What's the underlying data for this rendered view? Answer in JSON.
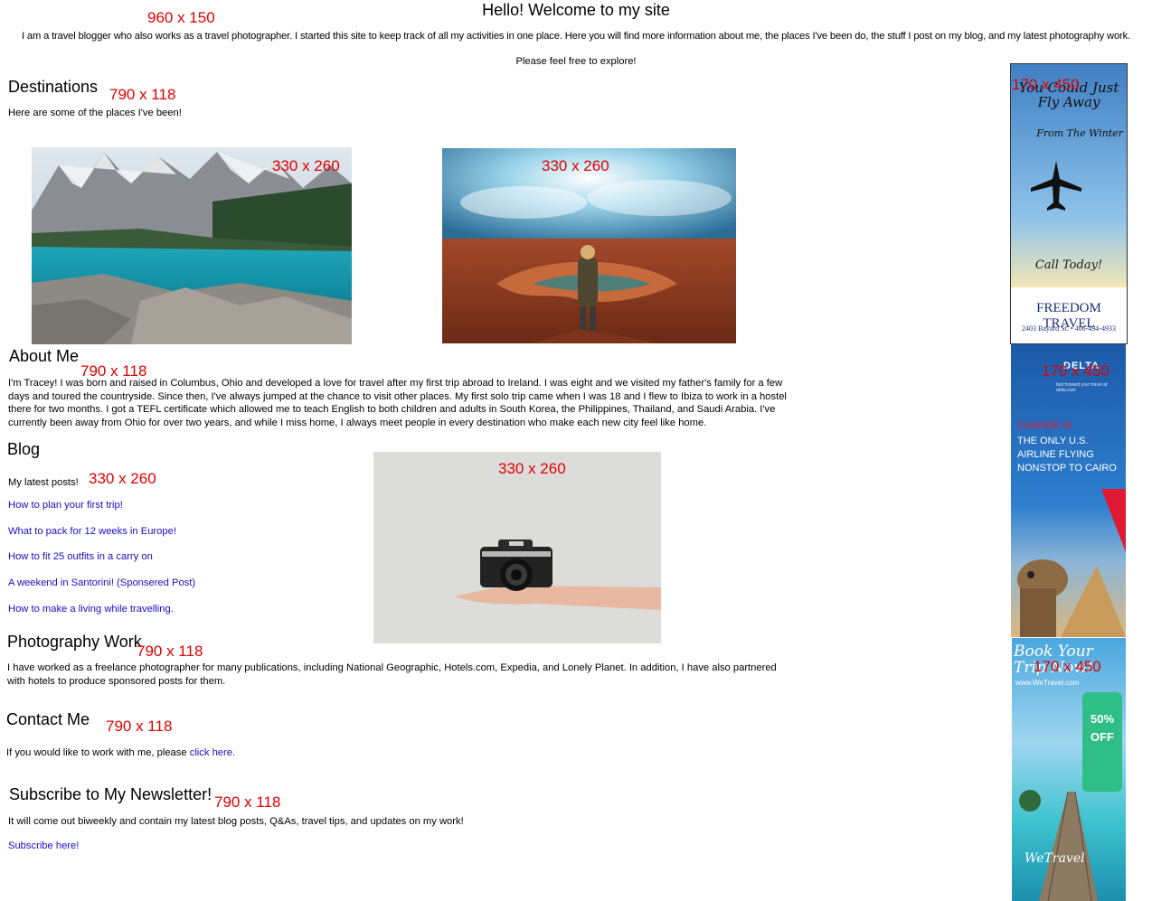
{
  "header": {
    "dim_label": "960 x 150",
    "title": "Hello! Welcome to my site",
    "intro": "I am a travel blogger who also works as a travel photographer. I started this site to keep track of all my activities in one place. Here you will find more information about me, the places I've been do, the stuff I post on my blog, and my latest photography work.",
    "intro2": "Please feel free to explore!"
  },
  "destinations": {
    "heading": "Destinations",
    "dim_label": "790 x 118",
    "text": "Here are some of the places I've been!",
    "photo1_dim": "330 x 260",
    "photo2_dim": "330 x 260"
  },
  "about": {
    "heading": "About Me",
    "dim_label": "790 x 118",
    "text": "I'm Tracey! I was born and raised in Columbus, Ohio and developed a love for travel after my first trip abroad to Ireland. I was eight and we visited my father's family for a few days and toured the countryside. Since then, I've always jumped at the chance to visit other places. My first solo trip came when I was 18 and I flew to Ibiza to work in a hostel there for two months. I got a TEFL certificate which allowed me to teach English to both children and adults in South Korea, the Philippines, Thailand, and Saudi Arabia. I've currently been away from Ohio for over two years, and while I miss home, I always meet people in every destination who make each new city feel like home."
  },
  "blog": {
    "heading": "Blog",
    "latest": "My latest posts!",
    "dim_label": "330 x 260",
    "photo_dim": "330 x 260",
    "posts": [
      "How to plan your first trip!",
      "What to pack for 12 weeks in Europe!",
      "How to fit 25 outfits in a carry on",
      "A weekend in Santorini! (Sponsered Post)",
      "How to make a living while travelling."
    ]
  },
  "photography": {
    "heading": "Photography Work",
    "dim_label": "790 x 118",
    "text": "I have worked as a freelance photographer for many publications, including National Geographic, Hotels.com, Expedia, and Lonely Planet. In addition, I have also partnered with hotels to produce sponsored posts for them."
  },
  "contact": {
    "heading": "Contact Me",
    "dim_label": "790 x 118",
    "text": "If you would like to work with me, please ",
    "link": "click here."
  },
  "newsletter": {
    "heading": "Subscribe to My Newsletter!",
    "dim_label": "790 x 118",
    "text": "It will come out biweekly and contain my latest blog posts, Q&As, travel tips, and updates on my work!",
    "link": "Subscribe here!"
  },
  "ads": {
    "ad1": {
      "dim": "170 x 450",
      "headline": "You Could Just Fly Away",
      "sub": "From The Winter",
      "cta": "Call Today!",
      "brand": "FREEDOM TRAVEL",
      "address": "2403 Bayard St. • 406-494-4933"
    },
    "ad2": {
      "dim": "170 x 450",
      "brand": "DELTA",
      "tag": "fast forward your travel at delta.com",
      "kicker": "CHANGE IS",
      "headline": "THE ONLY U.S. AIRLINE FLYING NONSTOP TO CAIRO"
    },
    "ad3": {
      "dim": "170 x 450",
      "headline": "Book Your Trip Now!",
      "url": "www.WeTravel.com",
      "badge": "50% OFF",
      "brand": "WeTravel"
    }
  },
  "colors": {
    "dim_red": "#e00000",
    "link_blue": "#1a0dcc",
    "delta_red": "#e01933",
    "freedom_navy": "#1c2f73"
  }
}
